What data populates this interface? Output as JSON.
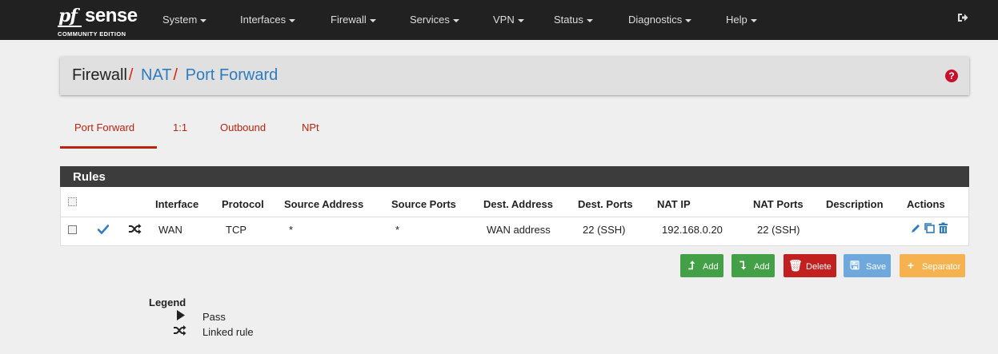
{
  "brand": {
    "prefix": "pf",
    "name": "sense",
    "edition": "COMMUNITY EDITION"
  },
  "nav": {
    "items": [
      "System",
      "Interfaces",
      "Firewall",
      "Services",
      "VPN",
      "Status",
      "Diagnostics",
      "Help"
    ],
    "logout_icon": "sign-out-icon"
  },
  "breadcrumb": {
    "root": "Firewall",
    "mid": "NAT",
    "leaf": "Port Forward",
    "separator": "/"
  },
  "help_icon_glyph": "?",
  "tabs": {
    "items": [
      "Port Forward",
      "1:1",
      "Outbound",
      "NPt"
    ],
    "active": "Port Forward"
  },
  "rules": {
    "title": "Rules",
    "columns": [
      "Interface",
      "Protocol",
      "Source Address",
      "Source Ports",
      "Dest. Address",
      "Dest. Ports",
      "NAT IP",
      "NAT Ports",
      "Description",
      "Actions"
    ],
    "rows": [
      {
        "interface": "WAN",
        "protocol": "TCP",
        "source_address": "*",
        "source_ports": "*",
        "dest_address": "WAN address",
        "dest_ports": "22 (SSH)",
        "nat_ip": "192.168.0.20",
        "nat_ports": "22 (SSH)",
        "description": "",
        "status": "pass",
        "linked": true
      }
    ]
  },
  "buttons": {
    "add_top": "Add",
    "add_bottom": "Add",
    "delete": "Delete",
    "save": "Save",
    "separator": "Separator"
  },
  "legend": {
    "title": "Legend",
    "pass": "Pass",
    "linked": "Linked rule"
  },
  "colors": {
    "accent_red": "#b92312",
    "link_blue": "#2e7bbf",
    "check_blue": "#2e7bbf",
    "nav_bg": "#212121"
  }
}
